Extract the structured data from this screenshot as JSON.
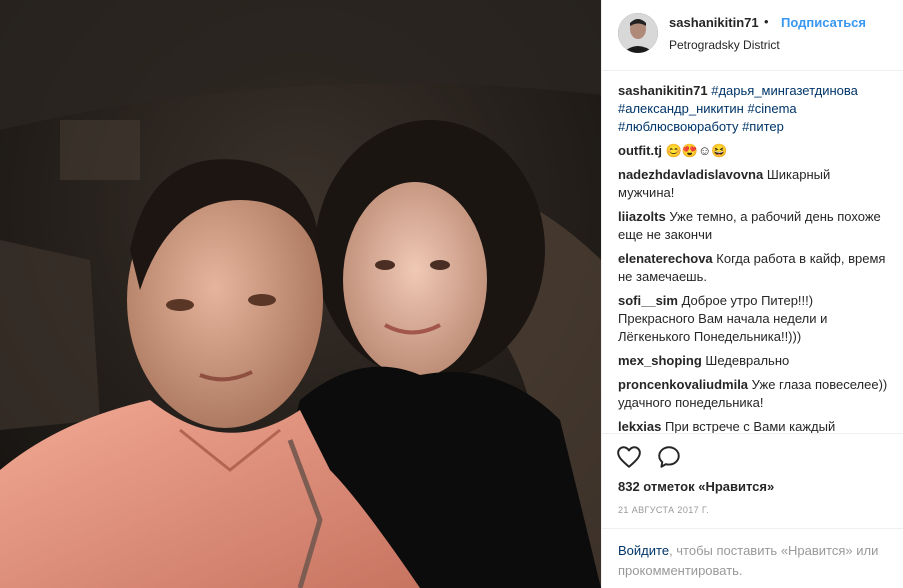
{
  "post": {
    "username": "sashanikitin71",
    "dot": "•",
    "follow_label": "Подписаться",
    "location": "Petrogradsky District"
  },
  "caption": {
    "username": "sashanikitin71",
    "tags": [
      "#дарья_мингазетдинова",
      "#александр_никитин",
      "#cinema",
      "#люблюсвоюработу",
      "#питер"
    ]
  },
  "comments": [
    {
      "user": "outfit.tj",
      "text": "😊😍☺😆"
    },
    {
      "user": "nadezhdavladislavovna",
      "text": "Шикарный мужчина!"
    },
    {
      "user": "liiazolts",
      "text": "Уже темно, а рабочий день похоже еще не закончи"
    },
    {
      "user": "elenaterechova",
      "text": "Когда работа в кайф, время не замечаешь."
    },
    {
      "user": "sofi__sim",
      "text": "Доброе утро Питер!!!) Прекрасного Вам начала недели и Лёгкенького Понедельника!!)))"
    },
    {
      "user": "mex_shoping",
      "text": "Шедеврально"
    },
    {
      "user": "proncenkovaliudmila",
      "text": "Уже глаза повеселее)) удачного понедельника!"
    },
    {
      "user": "lekxias",
      "text": "При встрече с Вами каждый"
    }
  ],
  "actions": {
    "like_icon": "heart-icon",
    "comment_icon": "comment-icon",
    "likes_text": "832 отметок «Нравится»",
    "date": "21 АВГУСТА 2017 Г."
  },
  "login_prompt": {
    "login_link": "Войдите",
    "rest": ", чтобы поставить «Нравится» или прокомментировать."
  }
}
